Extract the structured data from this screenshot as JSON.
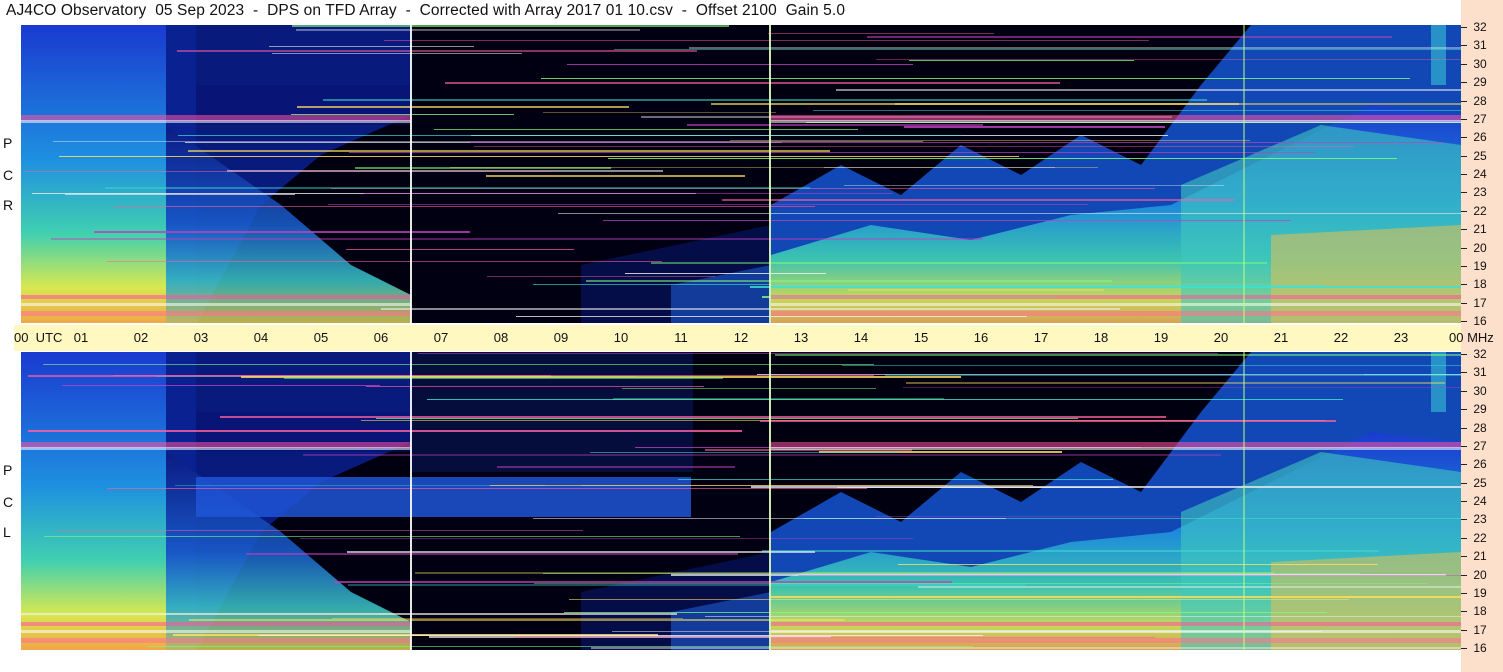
{
  "title": "AJ4CO Observatory  05 Sep 2023  -  DPS on TFD Array  -  Corrected with Array 2017 01 10.csv  -  Offset 2100  Gain 5.0",
  "time_axis": {
    "labels": [
      "00  UTC",
      "01",
      "02",
      "03",
      "04",
      "05",
      "06",
      "07",
      "08",
      "09",
      "10",
      "11",
      "12",
      "13",
      "14",
      "15",
      "16",
      "17",
      "18",
      "19",
      "20",
      "21",
      "22",
      "23",
      "00 MHz"
    ]
  },
  "panels": [
    {
      "polarization_letters": [
        "R",
        "C",
        "P"
      ]
    },
    {
      "polarization_letters": [
        "L",
        "C",
        "P"
      ]
    }
  ],
  "chart_data": {
    "type": "heatmap",
    "title": "AJ4CO Observatory  05 Sep 2023  -  DPS on TFD Array  -  Corrected with Array 2017 01 10.csv  -  Offset 2100  Gain 5.0",
    "x_unit": "UTC hour",
    "x_range": [
      0,
      24
    ],
    "y_unit": "MHz",
    "y_range": [
      16,
      32
    ],
    "y_ticks": [
      "32",
      "31",
      "30",
      "29",
      "28",
      "27",
      "26",
      "25",
      "24",
      "23",
      "22",
      "21",
      "20",
      "19",
      "18",
      "17",
      "16"
    ],
    "series": [
      {
        "name": "RCP"
      },
      {
        "name": "LCP"
      }
    ]
  }
}
